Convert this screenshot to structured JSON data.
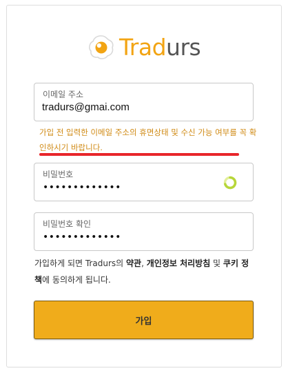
{
  "brand": {
    "name_part1": "Trad",
    "name_part2": "urs",
    "primary_color": "#f2a413",
    "secondary_color": "#555555"
  },
  "form": {
    "email": {
      "label": "이메일 주소",
      "value": "tradurs@gmai.com"
    },
    "warning": "가입 전 입력한 이메일 주소의 휴면상태 및 수신 가능 여부를 꼭 확인하시기 바랍니다.",
    "password": {
      "label": "비밀번호",
      "value": "•••••••••••••"
    },
    "password_confirm": {
      "label": "비밀번호 확인",
      "value": "•••••••••••••"
    },
    "terms": {
      "text_1": "가입하게 되면 Tradurs의 ",
      "link_terms": "약관",
      "sep": ", ",
      "link_privacy": "개인정보 처리방침",
      "text_2": " 및 ",
      "link_cookie": "쿠키 정책",
      "text_3": "에 동의하게 됩니다."
    },
    "submit_label": "가입",
    "submit_color": "#f0ac1b"
  },
  "icons": {
    "logo": "egg-logo-icon",
    "spinner": "loading-spinner-icon"
  }
}
